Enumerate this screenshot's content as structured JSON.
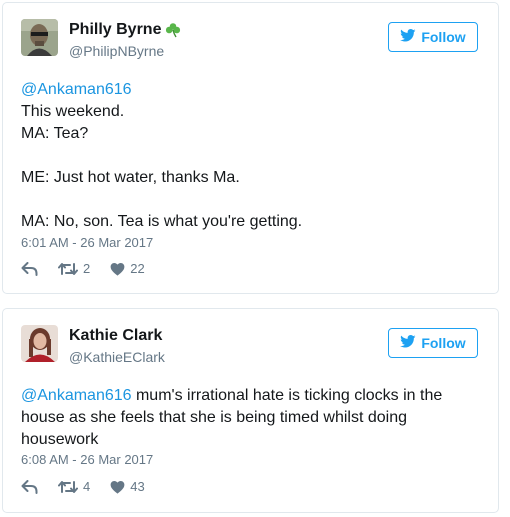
{
  "tweets": [
    {
      "name": "Philly Byrne",
      "handle": "@PhilipNByrne",
      "follow_label": "Follow",
      "mention": "@Ankaman616",
      "text": "\nThis weekend.\nMA: Tea?\n\nME: Just hot water, thanks Ma.\n\nMA: No, son. Tea is what you're getting.",
      "timestamp": "6:01 AM - 26 Mar 2017",
      "retweets": "2",
      "likes": "22"
    },
    {
      "name": "Kathie Clark",
      "handle": "@KathieEClark",
      "follow_label": "Follow",
      "mention": "@Ankaman616",
      "text": " mum's irrational hate is ticking clocks in the house as she feels that she is being timed whilst doing housework",
      "timestamp": "6:08 AM - 26 Mar 2017",
      "retweets": "4",
      "likes": "43"
    }
  ],
  "colors": {
    "twitter_blue": "#1da1f2",
    "mention_blue": "#1b95e0",
    "secondary_text": "#657786",
    "shamrock_green": "#59b64a"
  },
  "icons": [
    "shamrock-icon",
    "twitter-bird-icon",
    "reply-icon",
    "retweet-icon",
    "heart-icon"
  ]
}
